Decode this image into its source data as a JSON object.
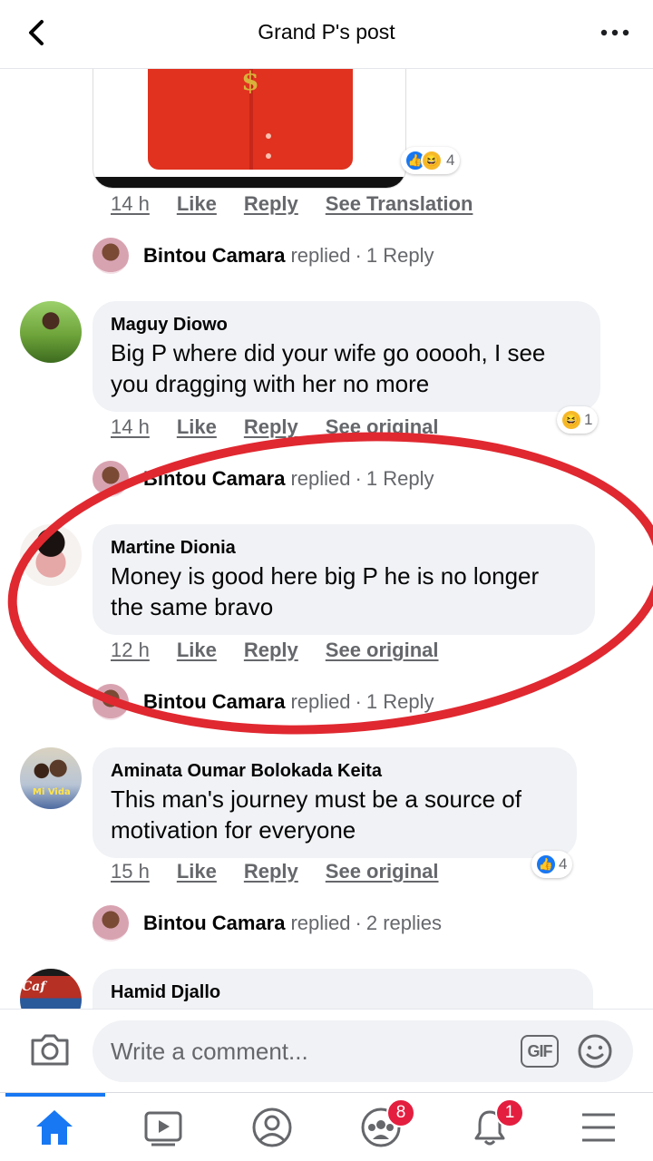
{
  "header": {
    "title": "Grand P's post"
  },
  "post_image": {
    "reactions_count": "4"
  },
  "first_actions": {
    "time": "14 h",
    "like": "Like",
    "reply": "Reply",
    "translate": "See Translation"
  },
  "comments": [
    {
      "reply_summary": {
        "name": "Bintou Camara",
        "verb": "replied",
        "sep": "·",
        "count": "1 Reply"
      }
    },
    {
      "author": "Maguy Diowo",
      "text": "Big P where did your wife go ooooh, I see you dragging with her no more",
      "time": "14 h",
      "like": "Like",
      "reply": "Reply",
      "extra": "See original",
      "reactions_count": "1",
      "reply_summary": {
        "name": "Bintou Camara",
        "verb": "replied",
        "sep": "·",
        "count": "1 Reply"
      }
    },
    {
      "author": "Martine Dionia",
      "text": "Money is good here big P he is no longer the same bravo",
      "time": "12 h",
      "like": "Like",
      "reply": "Reply",
      "extra": "See original",
      "reply_summary": {
        "name": "Bintou Camara",
        "verb": "replied",
        "sep": "·",
        "count": "1 Reply"
      }
    },
    {
      "author": "Aminata Oumar Bolokada Keita",
      "avatar_tag": "Mi Vida",
      "text": "This man's journey must be a source of motivation for everyone",
      "time": "15 h",
      "like": "Like",
      "reply": "Reply",
      "extra": "See original",
      "reactions_count": "4",
      "reply_summary": {
        "name": "Bintou Camara",
        "verb": "replied",
        "sep": "·",
        "count": "2 replies"
      }
    },
    {
      "author": "Hamid Djallo",
      "avatar_tag": "Caf"
    }
  ],
  "composer": {
    "placeholder": "Write a comment...",
    "gif_label": "GIF"
  },
  "tabbar": {
    "groups_badge": "8",
    "notifications_badge": "1",
    "active_color": "#1877f2"
  }
}
